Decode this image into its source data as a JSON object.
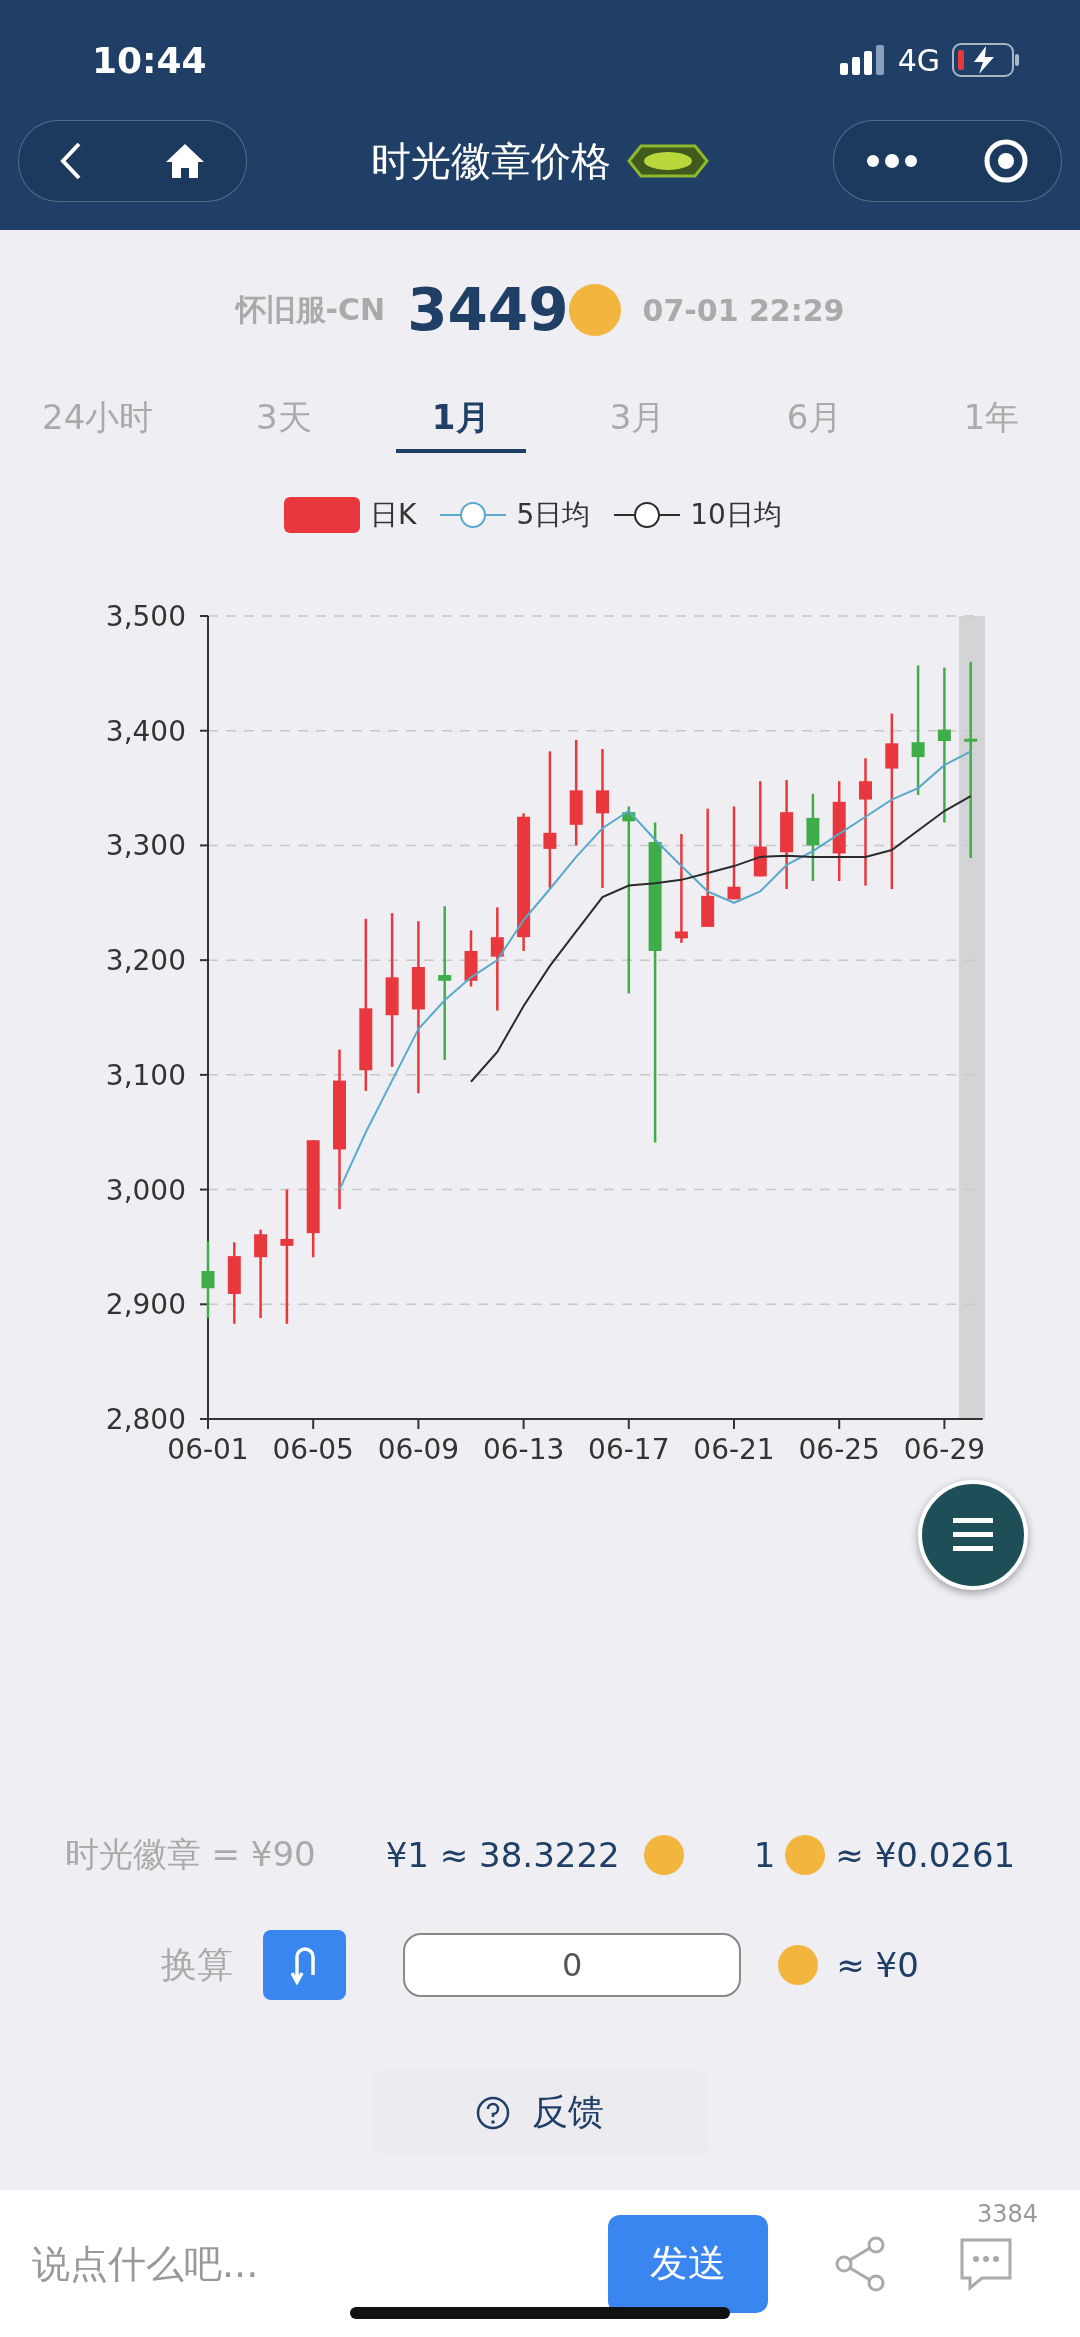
{
  "status_bar": {
    "time": "10:44",
    "network": "4G"
  },
  "nav": {
    "title": "时光徽章价格"
  },
  "price": {
    "server": "怀旧服-CN",
    "value": "3449",
    "timestamp": "07-01 22:29"
  },
  "tabs": [
    {
      "label": "24小时",
      "selected": false
    },
    {
      "label": "3天",
      "selected": false
    },
    {
      "label": "1月",
      "selected": true
    },
    {
      "label": "3月",
      "selected": false
    },
    {
      "label": "6月",
      "selected": false
    },
    {
      "label": "1年",
      "selected": false
    }
  ],
  "chart_data": {
    "type": "candlestick",
    "categories": [
      "06-01",
      null,
      null,
      null,
      "06-05",
      null,
      null,
      null,
      "06-09",
      null,
      null,
      null,
      "06-13",
      null,
      null,
      null,
      "06-17",
      null,
      null,
      null,
      "06-21",
      null,
      null,
      null,
      "06-25",
      null,
      null,
      null,
      "06-29",
      null
    ],
    "series": [
      {
        "name": "日K",
        "type": "candlestick",
        "color": "#e8383d",
        "ohlc": [
          null,
          [
            2909,
            2954,
            2883,
            2942
          ],
          [
            2941,
            2965,
            2888,
            2961
          ],
          [
            2951,
            3000,
            2883,
            2957
          ],
          [
            2962,
            3043,
            2941,
            3043
          ],
          [
            3035,
            3122,
            2983,
            3095
          ],
          [
            3104,
            3236,
            3086,
            3158
          ],
          [
            3152,
            3241,
            3107,
            3185
          ],
          [
            3157,
            3234,
            3084,
            3194
          ],
          null,
          [
            3182,
            3226,
            3177,
            3208
          ],
          [
            3203,
            3246,
            3156,
            3220
          ],
          [
            3220,
            3328,
            3208,
            3325
          ],
          [
            3297,
            3382,
            3263,
            3311
          ],
          [
            3318,
            3392,
            3300,
            3348
          ],
          [
            3328,
            3384,
            3263,
            3348
          ],
          null,
          null,
          [
            3219,
            3310,
            3215,
            3225
          ],
          [
            3229,
            3332,
            3229,
            3256
          ],
          [
            3253,
            3334,
            3253,
            3264
          ],
          [
            3273,
            3356,
            3273,
            3299
          ],
          [
            3294,
            3357,
            3262,
            3329
          ],
          null,
          [
            3293,
            3356,
            3269,
            3338
          ],
          [
            3340,
            3376,
            3265,
            3356
          ],
          [
            3367,
            3415,
            3262,
            3389
          ],
          null,
          null,
          null
        ]
      },
      {
        "type": "candlestick",
        "color": "#3fae4a",
        "ohlc": [
          [
            2929,
            2955,
            2888,
            2914
          ],
          null,
          null,
          null,
          null,
          null,
          null,
          null,
          null,
          [
            3187,
            3247,
            3113,
            3182
          ],
          null,
          null,
          null,
          null,
          null,
          null,
          [
            3329,
            3334,
            3171,
            3321
          ],
          [
            3303,
            3320,
            3041,
            3208
          ],
          null,
          null,
          null,
          null,
          null,
          [
            3324,
            3345,
            3269,
            3300
          ],
          null,
          null,
          null,
          [
            3390,
            3457,
            3344,
            3377
          ],
          [
            3401,
            3455,
            3320,
            3391
          ],
          [
            3393,
            3460,
            3289,
            3391
          ]
        ]
      },
      {
        "name": "5日均",
        "type": "line",
        "color": "#5aa9c9",
        "values": [
          null,
          null,
          null,
          null,
          null,
          3000,
          3050,
          3095,
          3140,
          3165,
          3185,
          3200,
          3235,
          3262,
          3290,
          3315,
          3330,
          3305,
          3282,
          3260,
          3250,
          3260,
          3283,
          3295,
          3310,
          3325,
          3340,
          3350,
          3370,
          3382
        ]
      },
      {
        "name": "10日均",
        "type": "line",
        "color": "#2b2b2b",
        "values": [
          null,
          null,
          null,
          null,
          null,
          null,
          null,
          null,
          null,
          null,
          3094,
          3120,
          3160,
          3195,
          3225,
          3255,
          3265,
          3267,
          3270,
          3276,
          3282,
          3290,
          3291,
          3290,
          3290,
          3290,
          3296,
          3313,
          3330,
          3343
        ]
      }
    ],
    "ylim": [
      2800,
      3500
    ],
    "grid": true,
    "yticks": [
      {
        "value": 2800,
        "label": "2,800"
      },
      {
        "value": 2900,
        "label": "2,900"
      },
      {
        "value": 3000,
        "label": "3,000"
      },
      {
        "value": 3100,
        "label": "3,100"
      },
      {
        "value": 3200,
        "label": "3,200"
      },
      {
        "value": 3300,
        "label": "3,300"
      },
      {
        "value": 3400,
        "label": "3,400"
      },
      {
        "value": 3500,
        "label": "3,500"
      }
    ]
  },
  "rates": {
    "badge_price": "时光徽章 = ¥90",
    "rmb_to_coin": "¥1 ≈ 38.3222",
    "coin_unit": "1",
    "coin_to_rmb": "≈ ¥0.0261"
  },
  "converter": {
    "label": "换算",
    "value": "0",
    "result": "≈ ¥0"
  },
  "feedback": {
    "label": "反馈"
  },
  "comment_bar": {
    "placeholder": "说点什么吧...",
    "send": "发送",
    "comment_count": "3384"
  }
}
